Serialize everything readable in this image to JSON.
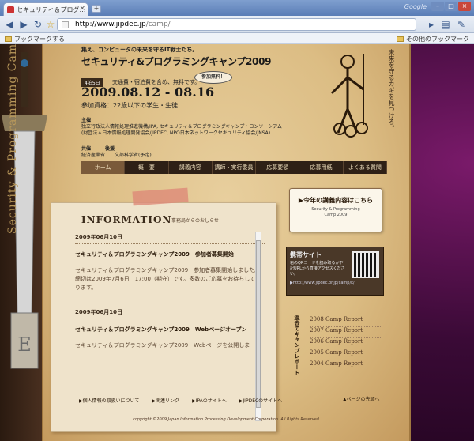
{
  "browser": {
    "tab_title": "セキュリティ＆プログ…",
    "new_tab": "+",
    "brand": "Google",
    "url_host": "http://www.jipdec.jp",
    "url_path": "/camp/",
    "bookmark_add": "ブックマークする",
    "other_bookmarks": "その他のブックマーク"
  },
  "header": {
    "catch": "集え、コンピュータの未来を守るIT戦士たち。",
    "title": "セキュリティ&プログラミングキャンプ2009",
    "days": "4泊5日",
    "fee": "交通費・宿泊費を含め、無料です。",
    "dates": "2009.08.12 - 08.16",
    "eligibility": "参加資格：22歳以下の学生・生徒",
    "free_badge": "参加無料！",
    "slogan": "未来を守るカギを見つけろ。"
  },
  "sponsor": {
    "label": "主催",
    "line1": "独立行政法人情報処理推進機構/IPA, セキュリティ＆プログラミングキャンプ・コンソーシアム",
    "line2": "(財団法人日本情報処理開発協会/JIPDEC, NPO日本ネットワークセキュリティ協会/JNSA)",
    "coop_label": "共催　　　後援",
    "coop": "経済産業省　　文部科学省(予定)"
  },
  "nav": [
    "ホーム",
    "概　要",
    "講義内容",
    "講師・実行委員",
    "応募要領",
    "応募用紙",
    "よくある質問"
  ],
  "left_vertical_text": "Security & Programming Camp 2009",
  "info": {
    "heading": "INFORMATION",
    "subheading": "事務局からのおしらせ",
    "items": [
      {
        "date": "2009年06月10日",
        "title": "セキュリティ＆プログラミングキャンプ2009　参加者募集開始",
        "body": "セキュリティ＆プログラミングキャンプ2009　参加者募集開始しました。締切は2009年7月6日　17:00（期守）です。多数のご応募をお待ちしております。"
      },
      {
        "date": "2009年06月10日",
        "title": "セキュリティ＆プログラミングキャンプ2009　Webページオープン",
        "body": "セキュリティ＆プログラミングキャンプ2009　Webページを公開しま"
      }
    ]
  },
  "lecture_banner": {
    "title": "▶今年の講義内容はこちら",
    "subtitle": "Security & Programming\nCamp 2009"
  },
  "mobile": {
    "title": "携帯サイト",
    "desc": "右のQRコードを読み取るか下記URLから直接アクセスください。",
    "url": "▶http://www.jipdec.or.jp/camp/k/"
  },
  "reports": {
    "label": "過去のキャンプレポート",
    "items": [
      "2008 Camp Report",
      "2007 Camp Report",
      "2006 Camp Report",
      "2005 Camp Report",
      "2004 Camp Report"
    ]
  },
  "footer": {
    "links": [
      "▶個人情報の取扱いについて",
      "▶関連リンク",
      "▶IPAのサイトへ",
      "▶JIPDECのサイトへ"
    ],
    "page_top": "▲ページの先頭へ",
    "copyright": "copyright ©2009 Japan Information Processing Development Corporation. All Rights Reserved."
  }
}
